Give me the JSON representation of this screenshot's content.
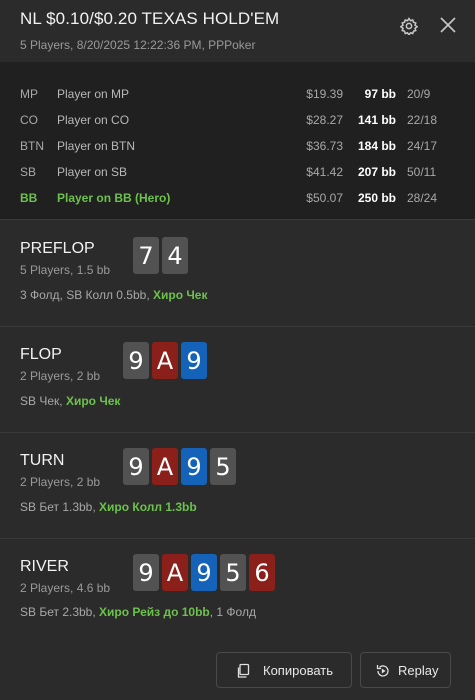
{
  "header": {
    "title": "NL $0.10/$0.20 TEXAS HOLD'EM",
    "subtitle": "5 Players, 8/20/2025 12:22:36 PM, PPPoker"
  },
  "players": [
    {
      "pos": "MP",
      "name": "Player on MP",
      "stack": "$19.39",
      "bb": "97 bb",
      "stats": "20/9"
    },
    {
      "pos": "CO",
      "name": "Player on CO",
      "stack": "$28.27",
      "bb": "141 bb",
      "stats": "22/18"
    },
    {
      "pos": "BTN",
      "name": "Player on BTN",
      "stack": "$36.73",
      "bb": "184 bb",
      "stats": "24/17"
    },
    {
      "pos": "SB",
      "name": "Player on SB",
      "stack": "$41.42",
      "bb": "207 bb",
      "stats": "50/11"
    },
    {
      "pos": "BB",
      "name": "Player on BB (Hero)",
      "stack": "$50.07",
      "bb": "250 bb",
      "stats": "28/24"
    }
  ],
  "streets": {
    "preflop": {
      "name": "PREFLOP",
      "info": "5 Players, 1.5 bb",
      "cards": [
        "7",
        "4"
      ],
      "action_plain": "3 Фолд, SB Колл 0.5bb, ",
      "action_hero": "Хиро Чек",
      "action_tail": ""
    },
    "flop": {
      "name": "FLOP",
      "info": "2 Players, 2 bb",
      "cards": [
        "9",
        "A",
        "9"
      ],
      "action_plain": "SB Чек, ",
      "action_hero": "Хиро Чек",
      "action_tail": ""
    },
    "turn": {
      "name": "TURN",
      "info": "2 Players, 2 bb",
      "cards": [
        "9",
        "A",
        "9",
        "5"
      ],
      "action_plain": "SB Бет 1.3bb, ",
      "action_hero": "Хиро Колл 1.3bb",
      "action_tail": ""
    },
    "river": {
      "name": "RIVER",
      "info": "2 Players, 4.6 bb",
      "cards": [
        "9",
        "A",
        "9",
        "5",
        "6"
      ],
      "action_plain": "SB Бет 2.3bb, ",
      "action_hero": "Хиро Рейз до 10bb",
      "action_tail": ", 1 Фолд"
    }
  },
  "card_colors": {
    "spade": "#525252",
    "heart": "#8b1f1a",
    "diamond": "#1463b8"
  },
  "hero_color": "#6cc24a",
  "buttons": {
    "copy": "Копировать",
    "replay": "Replay"
  },
  "icons": {
    "settings": "gear-icon",
    "close": "close-icon",
    "copy": "copy-icon",
    "replay": "replay-icon"
  }
}
